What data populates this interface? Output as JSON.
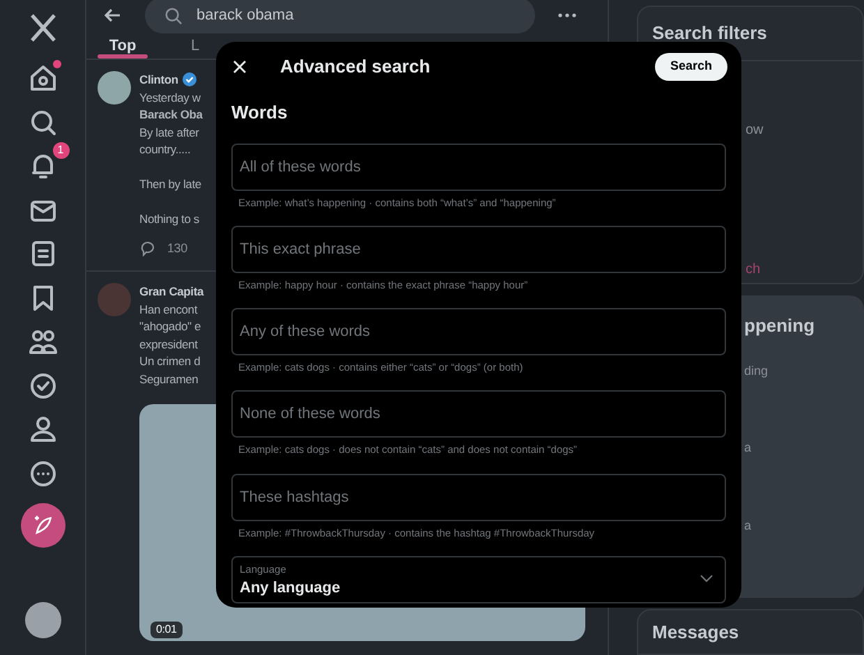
{
  "nav": {
    "notification_count": "1",
    "items": [
      {
        "kind": "home",
        "dot": true
      },
      {
        "kind": "search",
        "dot": false
      },
      {
        "kind": "bell",
        "dot": false
      },
      {
        "kind": "mail",
        "dot": false
      },
      {
        "kind": "list",
        "dot": false
      },
      {
        "kind": "bookmark",
        "dot": false
      },
      {
        "kind": "people",
        "dot": false
      },
      {
        "kind": "verified",
        "dot": false
      },
      {
        "kind": "person",
        "dot": false
      },
      {
        "kind": "more",
        "dot": false
      }
    ]
  },
  "search_bar": {
    "value": "barack obama"
  },
  "tabs": [
    {
      "label": "Top",
      "selected": true
    },
    {
      "label": "L",
      "selected": false
    }
  ],
  "posts": [
    {
      "author": "Clinton",
      "verified": true,
      "paragraphs": [
        [
          "Yesterday w",
          "**Barack Oba**",
          "By late after",
          "country....."
        ],
        [
          "Then by late"
        ],
        [
          "Nothing to s"
        ]
      ],
      "replies": "130",
      "media": false
    },
    {
      "author": "Gran Capita",
      "verified": false,
      "paragraphs": [
        [
          "Han encont",
          "\"ahogado\" e",
          "expresident",
          "Un crimen d",
          "Seguramen"
        ]
      ],
      "media": true,
      "video_time": "0:01"
    }
  ],
  "right": {
    "filters_title": "Search filters",
    "filter_fragments": [
      {
        "text": "ow",
        "kind": "plain"
      },
      {
        "text": "ch",
        "kind": "link"
      }
    ],
    "trends_title": "ppening",
    "trend_fragments": [
      "ding",
      "a",
      "a"
    ],
    "messages_title": "Messages"
  },
  "modal": {
    "title": "Advanced search",
    "search_button": "Search",
    "section": "Words",
    "fields": [
      {
        "placeholder": "All of these words",
        "hint": "Example: what’s happening · contains both “what’s” and “happening”"
      },
      {
        "placeholder": "This exact phrase",
        "hint": "Example: happy hour · contains the exact phrase “happy hour”"
      },
      {
        "placeholder": "Any of these words",
        "hint": "Example: cats dogs · contains either “cats” or “dogs” (or both)"
      },
      {
        "placeholder": "None of these words",
        "hint": "Example: cats dogs · does not contain “cats” and does not contain “dogs”"
      },
      {
        "placeholder": "These hashtags",
        "hint": "Example: #ThrowbackThursday · contains the hashtag #ThrowbackThursday"
      }
    ],
    "language": {
      "label": "Language",
      "value": "Any language"
    }
  }
}
